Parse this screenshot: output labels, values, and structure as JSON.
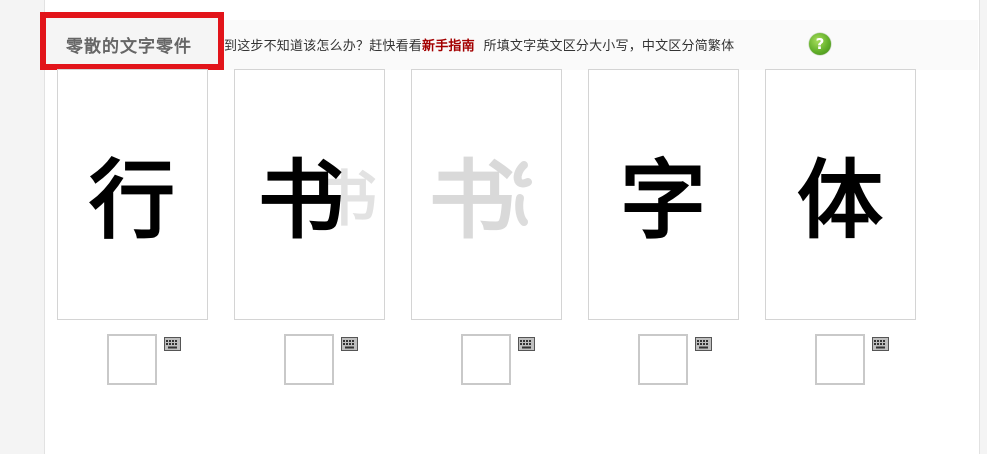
{
  "header": {
    "title": "零散的文字零件",
    "hint_prefix": "到这步不知道该怎么办？赶快看看",
    "guide_link": "新手指南",
    "hint_suffix": "所填文字英文区分大小写，中文区分简繁体",
    "help_icon": "question-mark-icon",
    "help_symbol": "?",
    "accent_color": "#e2141a",
    "link_color": "#a30000",
    "help_color": "#63b02a"
  },
  "fragments": [
    {
      "glyph": "行",
      "faded": false,
      "input_value": "",
      "input_icon": "keyboard-icon"
    },
    {
      "glyph": "书",
      "faded": false,
      "input_value": "",
      "input_icon": "keyboard-icon"
    },
    {
      "glyph": "书",
      "faded": true,
      "input_value": "",
      "input_icon": "keyboard-icon"
    },
    {
      "glyph": "字",
      "faded": false,
      "input_value": "",
      "input_icon": "keyboard-icon"
    },
    {
      "glyph": "体",
      "faded": false,
      "input_value": "",
      "input_icon": "keyboard-icon"
    }
  ]
}
